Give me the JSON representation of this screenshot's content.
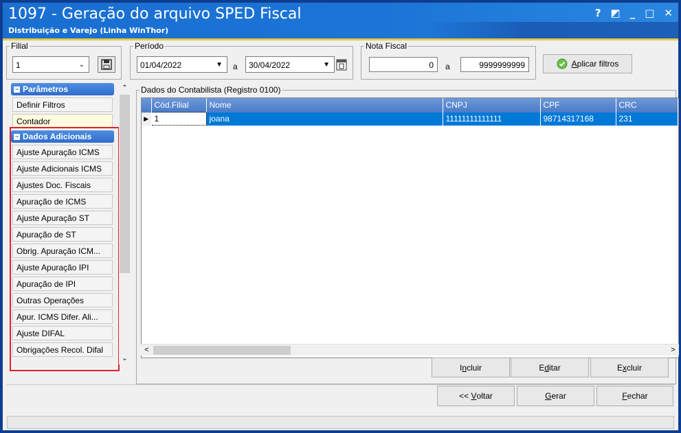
{
  "window": {
    "title": "1097 - Geração do arquivo SPED Fiscal",
    "subtitle": "Distribuição e Varejo (Linha WinThor)",
    "buttons": {
      "help": "?",
      "restore": "◩",
      "minimize": "_",
      "maximize": "□",
      "close": "✕"
    }
  },
  "filial": {
    "legend": "Filial",
    "value": "1"
  },
  "periodo": {
    "legend": "Período",
    "start": "01/04/2022",
    "connector": "a",
    "end": "30/04/2022"
  },
  "nota_fiscal": {
    "legend": "Nota Fiscal",
    "start": "0",
    "connector": "a",
    "end": "9999999999"
  },
  "apply_filters": {
    "label_prefix": "",
    "label_accel": "A",
    "label_rest": "plicar filtros"
  },
  "sidebar": {
    "parametros": {
      "title": "Parâmetros",
      "items": [
        "Definir Filtros",
        "Contador"
      ]
    },
    "dados_adicionais": {
      "title": "Dados Adicionais",
      "items": [
        "Ajuste Apuração ICMS",
        "Ajuste Adicionais ICMS",
        "Ajustes Doc. Fiscais",
        "Apuração de ICMS",
        "Ajuste Apuração ST",
        "Apuração de ST",
        "Obrig. Apuração ICM...",
        "Ajuste Apuração IPI",
        "Apuração de IPI",
        "Outras Operações",
        "Apur. ICMS Difer. Ali...",
        "Ajuste DIFAL",
        "Obrigações Recol. Difal"
      ]
    }
  },
  "grid": {
    "legend": "Dados do Contabilista (Registro 0100)",
    "columns": [
      "Cód.Filial",
      "Nome",
      "CNPJ",
      "CPF",
      "CRC"
    ],
    "rows": [
      {
        "cod_filial": "1",
        "nome": "joana",
        "cnpj": "11111111111111",
        "cpf": "98714317168",
        "crc": "231"
      }
    ]
  },
  "grid_actions": {
    "incluir": {
      "pre": "I",
      "accel": "n",
      "post": "cluir"
    },
    "editar": {
      "pre": "E",
      "accel": "d",
      "post": "itar"
    },
    "excluir": {
      "pre": "E",
      "accel": "x",
      "post": "cluir"
    }
  },
  "footer_actions": {
    "voltar": {
      "pre": "<< ",
      "accel": "V",
      "post": "oltar"
    },
    "gerar": {
      "pre": "",
      "accel": "G",
      "post": "erar"
    },
    "fechar": {
      "pre": "",
      "accel": "F",
      "post": "echar"
    }
  },
  "colors": {
    "title_bar": "#1a6fd1",
    "selection": "#0078d7",
    "highlight_box": "#e0202a"
  }
}
